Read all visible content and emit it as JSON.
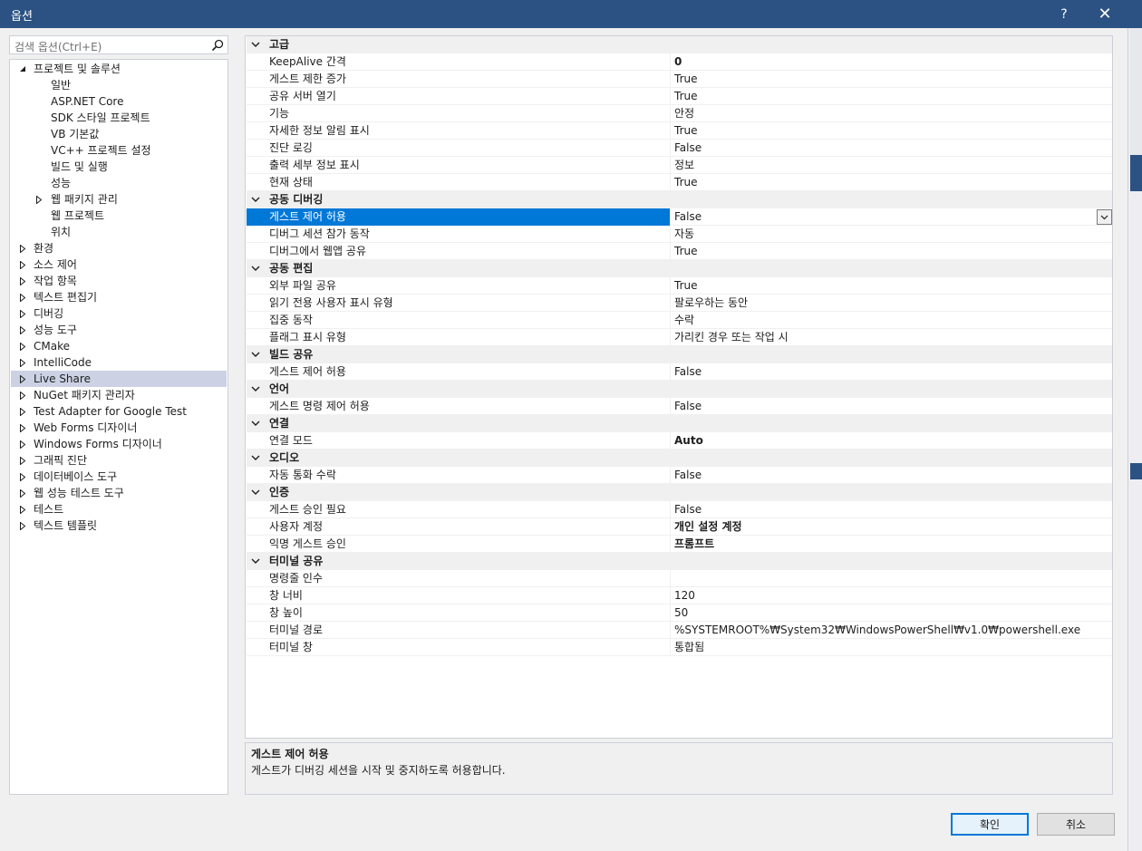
{
  "window": {
    "title": "옵션",
    "help_label": "?",
    "close_label": "✕"
  },
  "search": {
    "placeholder": "검색 옵션(Ctrl+E)"
  },
  "tree": [
    {
      "label": "프로젝트 및 솔루션",
      "level": 0,
      "expander": "expanded"
    },
    {
      "label": "일반",
      "level": 1,
      "expander": "none"
    },
    {
      "label": "ASP.NET Core",
      "level": 1,
      "expander": "none"
    },
    {
      "label": "SDK 스타일 프로젝트",
      "level": 1,
      "expander": "none"
    },
    {
      "label": "VB 기본값",
      "level": 1,
      "expander": "none"
    },
    {
      "label": "VC++ 프로젝트 설정",
      "level": 1,
      "expander": "none"
    },
    {
      "label": "빌드 및 실행",
      "level": 1,
      "expander": "none"
    },
    {
      "label": "성능",
      "level": 1,
      "expander": "none"
    },
    {
      "label": "웹 패키지 관리",
      "level": 1,
      "expander": "collapsed"
    },
    {
      "label": "웹 프로젝트",
      "level": 1,
      "expander": "none"
    },
    {
      "label": "위치",
      "level": 1,
      "expander": "none"
    },
    {
      "label": "환경",
      "level": 0,
      "expander": "collapsed"
    },
    {
      "label": "소스 제어",
      "level": 0,
      "expander": "collapsed"
    },
    {
      "label": "작업 항목",
      "level": 0,
      "expander": "collapsed"
    },
    {
      "label": "텍스트 편집기",
      "level": 0,
      "expander": "collapsed"
    },
    {
      "label": "디버깅",
      "level": 0,
      "expander": "collapsed"
    },
    {
      "label": "성능 도구",
      "level": 0,
      "expander": "collapsed"
    },
    {
      "label": "CMake",
      "level": 0,
      "expander": "collapsed"
    },
    {
      "label": "IntelliCode",
      "level": 0,
      "expander": "collapsed"
    },
    {
      "label": "Live Share",
      "level": 0,
      "expander": "collapsed",
      "selected": true
    },
    {
      "label": "NuGet 패키지 관리자",
      "level": 0,
      "expander": "collapsed"
    },
    {
      "label": "Test Adapter for Google Test",
      "level": 0,
      "expander": "collapsed"
    },
    {
      "label": "Web Forms 디자이너",
      "level": 0,
      "expander": "collapsed"
    },
    {
      "label": "Windows Forms 디자이너",
      "level": 0,
      "expander": "collapsed"
    },
    {
      "label": "그래픽 진단",
      "level": 0,
      "expander": "collapsed"
    },
    {
      "label": "데이터베이스 도구",
      "level": 0,
      "expander": "collapsed"
    },
    {
      "label": "웹 성능 테스트 도구",
      "level": 0,
      "expander": "collapsed"
    },
    {
      "label": "테스트",
      "level": 0,
      "expander": "collapsed"
    },
    {
      "label": "텍스트 템플릿",
      "level": 0,
      "expander": "collapsed"
    }
  ],
  "grid": [
    {
      "category": "고급",
      "props": [
        {
          "name": "KeepAlive 간격",
          "value": "0",
          "bold": true
        },
        {
          "name": "게스트 제한 증가",
          "value": "True"
        },
        {
          "name": "공유 서버 열기",
          "value": "True"
        },
        {
          "name": "기능",
          "value": "안정"
        },
        {
          "name": "자세한 정보 알림 표시",
          "value": "True"
        },
        {
          "name": "진단 로깅",
          "value": "False"
        },
        {
          "name": "출력 세부 정보 표시",
          "value": "정보"
        },
        {
          "name": "현재 상태",
          "value": "True"
        }
      ]
    },
    {
      "category": "공동 디버깅",
      "props": [
        {
          "name": "게스트 제어 허용",
          "value": "False",
          "selected": true
        },
        {
          "name": "디버그 세션 참가 동작",
          "value": "자동"
        },
        {
          "name": "디버그에서 웹앱 공유",
          "value": "True"
        }
      ]
    },
    {
      "category": "공동 편집",
      "props": [
        {
          "name": "외부 파일 공유",
          "value": "True"
        },
        {
          "name": "읽기 전용 사용자 표시 유형",
          "value": "팔로우하는 동안"
        },
        {
          "name": "집중 동작",
          "value": "수락"
        },
        {
          "name": "플래그 표시 유형",
          "value": "가리킨 경우 또는 작업 시"
        }
      ]
    },
    {
      "category": "빌드 공유",
      "props": [
        {
          "name": "게스트 제어 허용",
          "value": "False"
        }
      ]
    },
    {
      "category": "언어",
      "props": [
        {
          "name": "게스트 명령 제어 허용",
          "value": "False"
        }
      ]
    },
    {
      "category": "연결",
      "props": [
        {
          "name": "연결 모드",
          "value": "Auto",
          "bold": true
        }
      ]
    },
    {
      "category": "오디오",
      "props": [
        {
          "name": "자동 통화 수락",
          "value": "False"
        }
      ]
    },
    {
      "category": "인증",
      "props": [
        {
          "name": "게스트 승인 필요",
          "value": "False"
        },
        {
          "name": "사용자 계정",
          "value": "개인 설정 계정",
          "bold": true
        },
        {
          "name": "익명 게스트 승인",
          "value": "프롬프트",
          "bold": true
        }
      ]
    },
    {
      "category": "터미널 공유",
      "props": [
        {
          "name": "명령줄 인수",
          "value": ""
        },
        {
          "name": "창 너비",
          "value": "120"
        },
        {
          "name": "창 높이",
          "value": "50"
        },
        {
          "name": "터미널 경로",
          "value": "%SYSTEMROOT%₩System32₩WindowsPowerShell₩v1.0₩powershell.exe"
        },
        {
          "name": "터미널 창",
          "value": "통합됨"
        }
      ]
    }
  ],
  "description": {
    "title": "게스트 제어 허용",
    "text": "게스트가 디버깅 세션을 시작 및 중지하도록 허용합니다."
  },
  "buttons": {
    "ok_label": "확인",
    "cancel_label": "취소"
  },
  "icons": {
    "search": "search-icon",
    "dropdown": "chevron-down-icon",
    "collapse": "chevron-down-icon",
    "tree_expanded": "triangle-expanded-icon",
    "tree_collapsed": "triangle-collapsed-icon"
  },
  "colors": {
    "titlebar": "#2b5282",
    "selection": "#0078d7",
    "tree_selection": "#ccd2e4"
  }
}
